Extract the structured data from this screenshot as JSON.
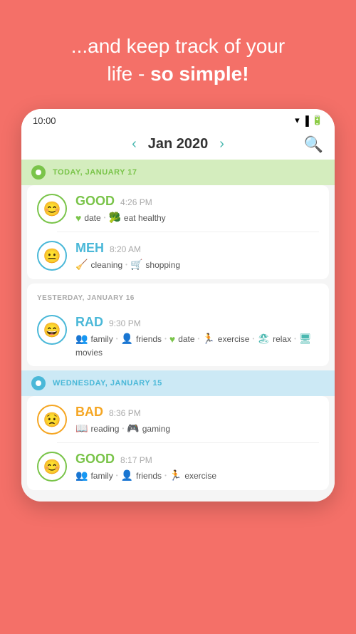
{
  "header": {
    "line1": "...and keep track of your",
    "line2": "life - ",
    "line2_bold": "so simple!"
  },
  "status_bar": {
    "time": "10:00"
  },
  "nav": {
    "month": "Jan 2020",
    "prev_arrow": "‹",
    "next_arrow": "›"
  },
  "days": [
    {
      "id": "today",
      "label": "TODAY, JANUARY 17",
      "type": "today",
      "entries": [
        {
          "mood": "GOOD",
          "mood_type": "good",
          "time": "4:26 PM",
          "face": "😊",
          "tags": [
            {
              "icon": "♥",
              "icon_class": "green",
              "label": "date"
            },
            {
              "icon": "🥦",
              "icon_class": "green",
              "label": "eat healthy"
            }
          ]
        },
        {
          "mood": "MEH",
          "mood_type": "meh",
          "time": "8:20 AM",
          "face": "😐",
          "tags": [
            {
              "icon": "🧹",
              "icon_class": "teal",
              "label": "cleaning"
            },
            {
              "icon": "🛒",
              "icon_class": "teal",
              "label": "shopping"
            }
          ]
        }
      ]
    },
    {
      "id": "yesterday",
      "label": "YESTERDAY, JANUARY 16",
      "type": "yesterday",
      "entries": [
        {
          "mood": "RAD",
          "mood_type": "rad",
          "time": "9:30 PM",
          "face": "😄",
          "tags": [
            {
              "icon": "👥",
              "icon_class": "teal",
              "label": "family"
            },
            {
              "icon": "👤",
              "icon_class": "teal",
              "label": "friends"
            },
            {
              "icon": "♥",
              "icon_class": "green",
              "label": "date"
            },
            {
              "icon": "🏃",
              "icon_class": "teal",
              "label": "exercise"
            },
            {
              "icon": "🏖",
              "icon_class": "teal",
              "label": "relax"
            },
            {
              "icon": "🖥",
              "icon_class": "teal",
              "label": "movies"
            }
          ]
        }
      ]
    },
    {
      "id": "wednesday",
      "label": "WEDNESDAY, JANUARY 15",
      "type": "wednesday",
      "entries": [
        {
          "mood": "BAD",
          "mood_type": "bad",
          "time": "8:36 PM",
          "face": "😟",
          "tags": [
            {
              "icon": "📖",
              "icon_class": "orange",
              "label": "reading"
            },
            {
              "icon": "🎮",
              "icon_class": "orange",
              "label": "gaming"
            }
          ]
        },
        {
          "mood": "GOOD",
          "mood_type": "good",
          "time": "8:17 PM",
          "face": "😊",
          "tags": [
            {
              "icon": "👥",
              "icon_class": "teal",
              "label": "family"
            },
            {
              "icon": "👤",
              "icon_class": "green",
              "label": "friends"
            },
            {
              "icon": "🏃",
              "icon_class": "teal",
              "label": "exercise"
            }
          ]
        }
      ]
    }
  ]
}
